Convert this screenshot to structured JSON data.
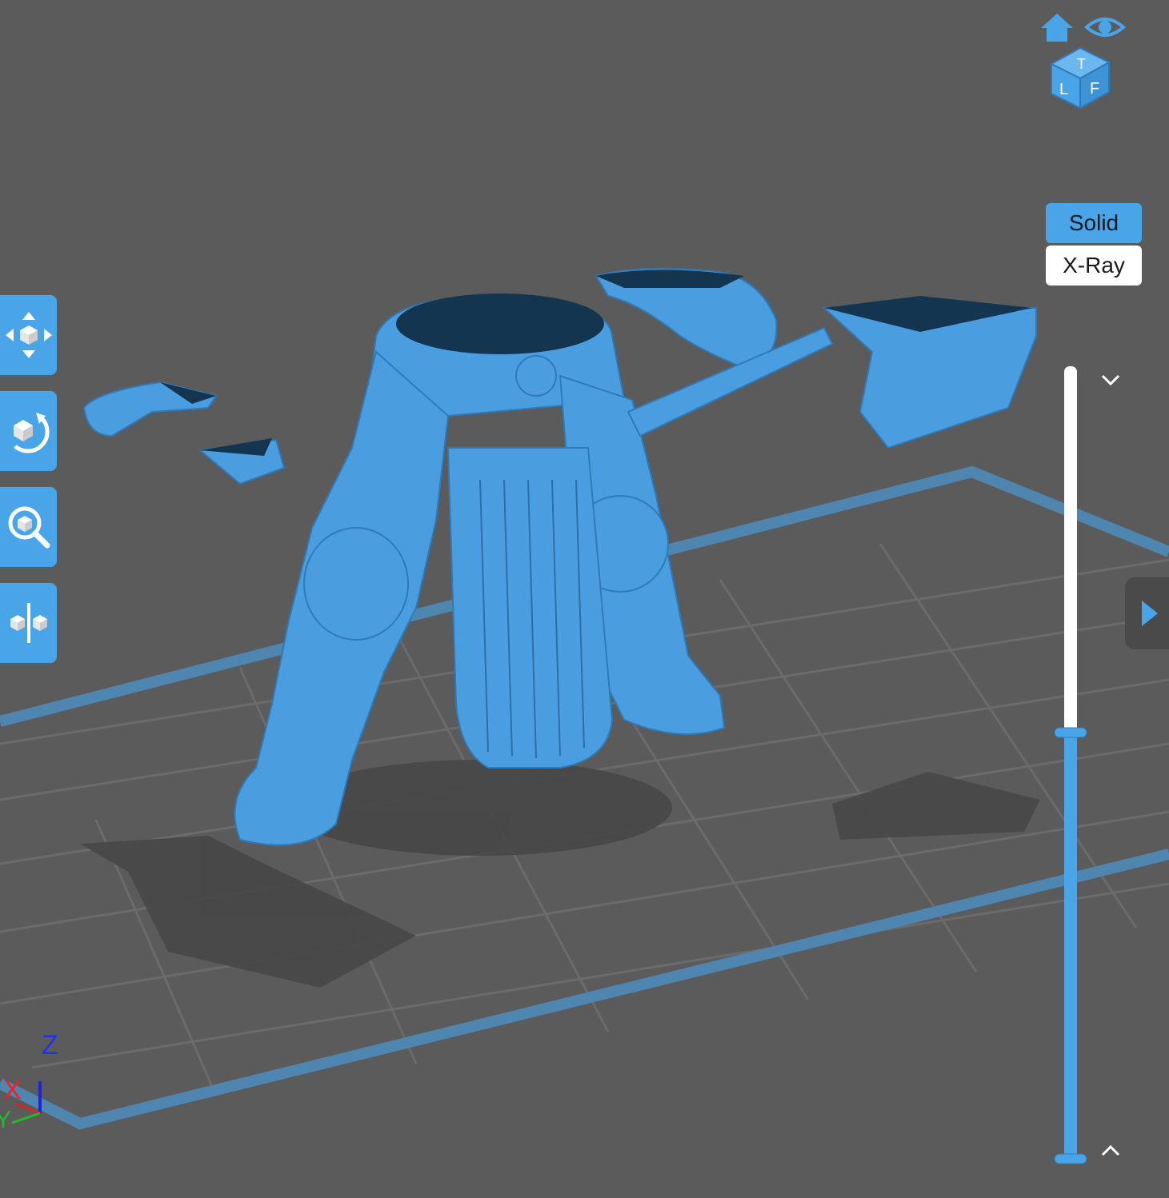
{
  "view_mode": {
    "solid_label": "Solid",
    "xray_label": "X-Ray",
    "active": "Solid"
  },
  "left_toolbar": {
    "items": [
      {
        "name": "move-tool",
        "icon": "move-arrows-cube-icon"
      },
      {
        "name": "rotate-tool",
        "icon": "rotate-cube-icon"
      },
      {
        "name": "scale-tool",
        "icon": "scale-magnifier-cube-icon"
      },
      {
        "name": "mirror-tool",
        "icon": "mirror-cubes-icon"
      }
    ]
  },
  "view_cube": {
    "home_icon": "home-icon",
    "eye_icon": "eye-icon",
    "faces": {
      "top": "T",
      "left": "L",
      "front": "F"
    }
  },
  "axis_gizmo": {
    "z_label": "Z",
    "x_label": "X",
    "y_label": "Y"
  },
  "layer_slider": {
    "up_icon": "chevron-up-icon",
    "down_icon": "chevron-down-icon",
    "handle_position": 0.04
  },
  "side_panel": {
    "expand_icon": "triangle-right-icon"
  },
  "colors": {
    "background": "#5b5b5b",
    "accent": "#4aa5e8",
    "model": "#4a9ee0",
    "model_cut": "#143550",
    "plate_line": "#6b6b6b",
    "plate_border": "#4f86b0"
  }
}
